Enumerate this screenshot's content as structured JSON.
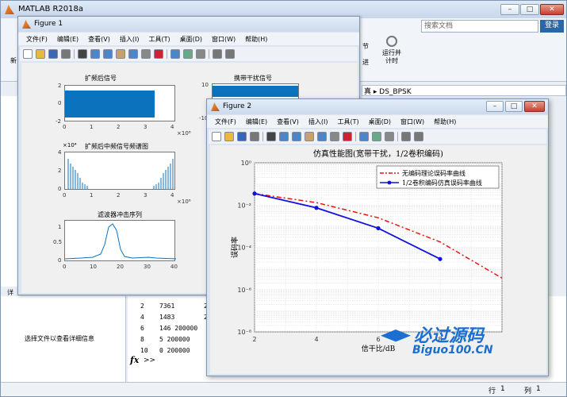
{
  "matlab": {
    "title": "MATLAB R2018a",
    "search_placeholder": "搜索文档",
    "login": "登录",
    "ribbon_labels": {
      "section": "节",
      "run_label": "进",
      "runtimer": "运行并\n计时"
    },
    "breadcrumb": "DS_BPSK",
    "breadcrumb_prefix": "真 ▸",
    "left_btn": "新",
    "left_footer": "详",
    "details_text": "选择文件以查看详细信息",
    "status_row": "行",
    "status_col": "列",
    "status_row_val": "1",
    "status_col_val": "1",
    "fx": "fx",
    ">>": ">>",
    "cmd_rows": [
      [
        "2",
        "7361",
        "2000"
      ],
      [
        "4",
        "1483",
        "2000"
      ],
      [
        "6",
        "146 200000",
        ""
      ],
      [
        "8",
        "5 200000",
        ""
      ],
      [
        "10",
        "0 200000",
        ""
      ]
    ]
  },
  "menu": [
    "文件(F)",
    "编辑(E)",
    "查看(V)",
    "插入(I)",
    "工具(T)",
    "桌面(D)",
    "窗口(W)",
    "帮助(H)"
  ],
  "figure1": {
    "title": "Figure 1",
    "plot1_title": "扩频后信号",
    "plot1_yticks": [
      "2",
      "0",
      "-2"
    ],
    "plot1_xticks": [
      "0",
      "1",
      "2",
      "3",
      "4"
    ],
    "plot1_xexp": "×10⁶",
    "plot2_title": "携带干扰信号",
    "plot2_yticks": [
      "10",
      "0",
      "-10"
    ],
    "plot3_title": "扩频后中频信号频谱图",
    "plot3_yexp": "×10⁴",
    "plot3_yticks": [
      "4",
      "2",
      "0"
    ],
    "plot3_xticks": [
      "0",
      "1",
      "2",
      "3",
      "4"
    ],
    "plot3_xexp": "×10⁶",
    "plot4_title": "滤波器冲击序列",
    "plot4_yticks": [
      "1",
      "0.5",
      "0"
    ],
    "plot4_xticks": [
      "0",
      "10",
      "20",
      "30",
      "40"
    ]
  },
  "figure2": {
    "title": "Figure 2",
    "watermark": "必过源码",
    "watermark_url": "Biguo100.CN",
    "ytick_labels": [
      "10⁰",
      "10⁻²",
      "10⁻⁴",
      "10⁻⁶",
      "10⁻⁸"
    ]
  },
  "chart_data": {
    "type": "line",
    "title": "仿真性能图(宽带干扰，1/2卷积编码)",
    "xlabel": "信干比/dB",
    "ylabel": "误码率",
    "x_ticks": [
      "2",
      "4",
      "6",
      "8"
    ],
    "xlim": [
      2,
      10
    ],
    "ylim": [
      1e-08,
      1
    ],
    "yscale": "log",
    "grid": true,
    "legend_position": "top-right",
    "series": [
      {
        "name": "无编码理论误码率曲线",
        "color": "#e8150e",
        "style": "dash-dot",
        "x": [
          2,
          4,
          6,
          8,
          10
        ],
        "y": [
          0.035,
          0.013,
          0.0025,
          0.00018,
          3.5e-06
        ]
      },
      {
        "name": "1/2卷积编码仿真误码率曲线",
        "color": "#1010e0",
        "style": "solid-markers",
        "x": [
          2,
          4,
          6,
          8
        ],
        "y": [
          0.035,
          0.0074,
          0.0008,
          2.8e-05
        ]
      }
    ]
  }
}
